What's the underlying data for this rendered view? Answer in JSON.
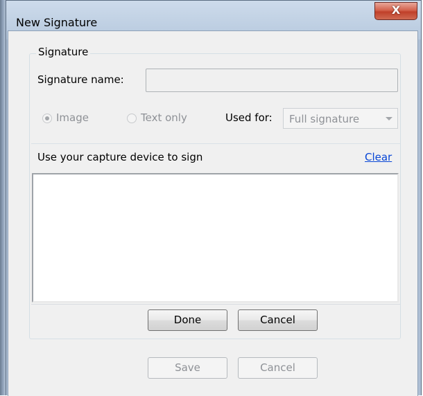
{
  "window": {
    "title": "New Signature",
    "close_label": "X"
  },
  "signature_group": {
    "label": "Signature",
    "name_label": "Signature name:",
    "name_value": ""
  },
  "options": {
    "image_label": "Image",
    "image_selected": true,
    "text_only_label": "Text only",
    "used_for_label": "Used for:",
    "used_for_value": "Full signature"
  },
  "capture": {
    "instruction": "Use your capture device to sign",
    "clear_label": "Clear",
    "done_label": "Done",
    "cancel_label": "Cancel"
  },
  "footer": {
    "save_label": "Save",
    "cancel_label": "Cancel"
  }
}
